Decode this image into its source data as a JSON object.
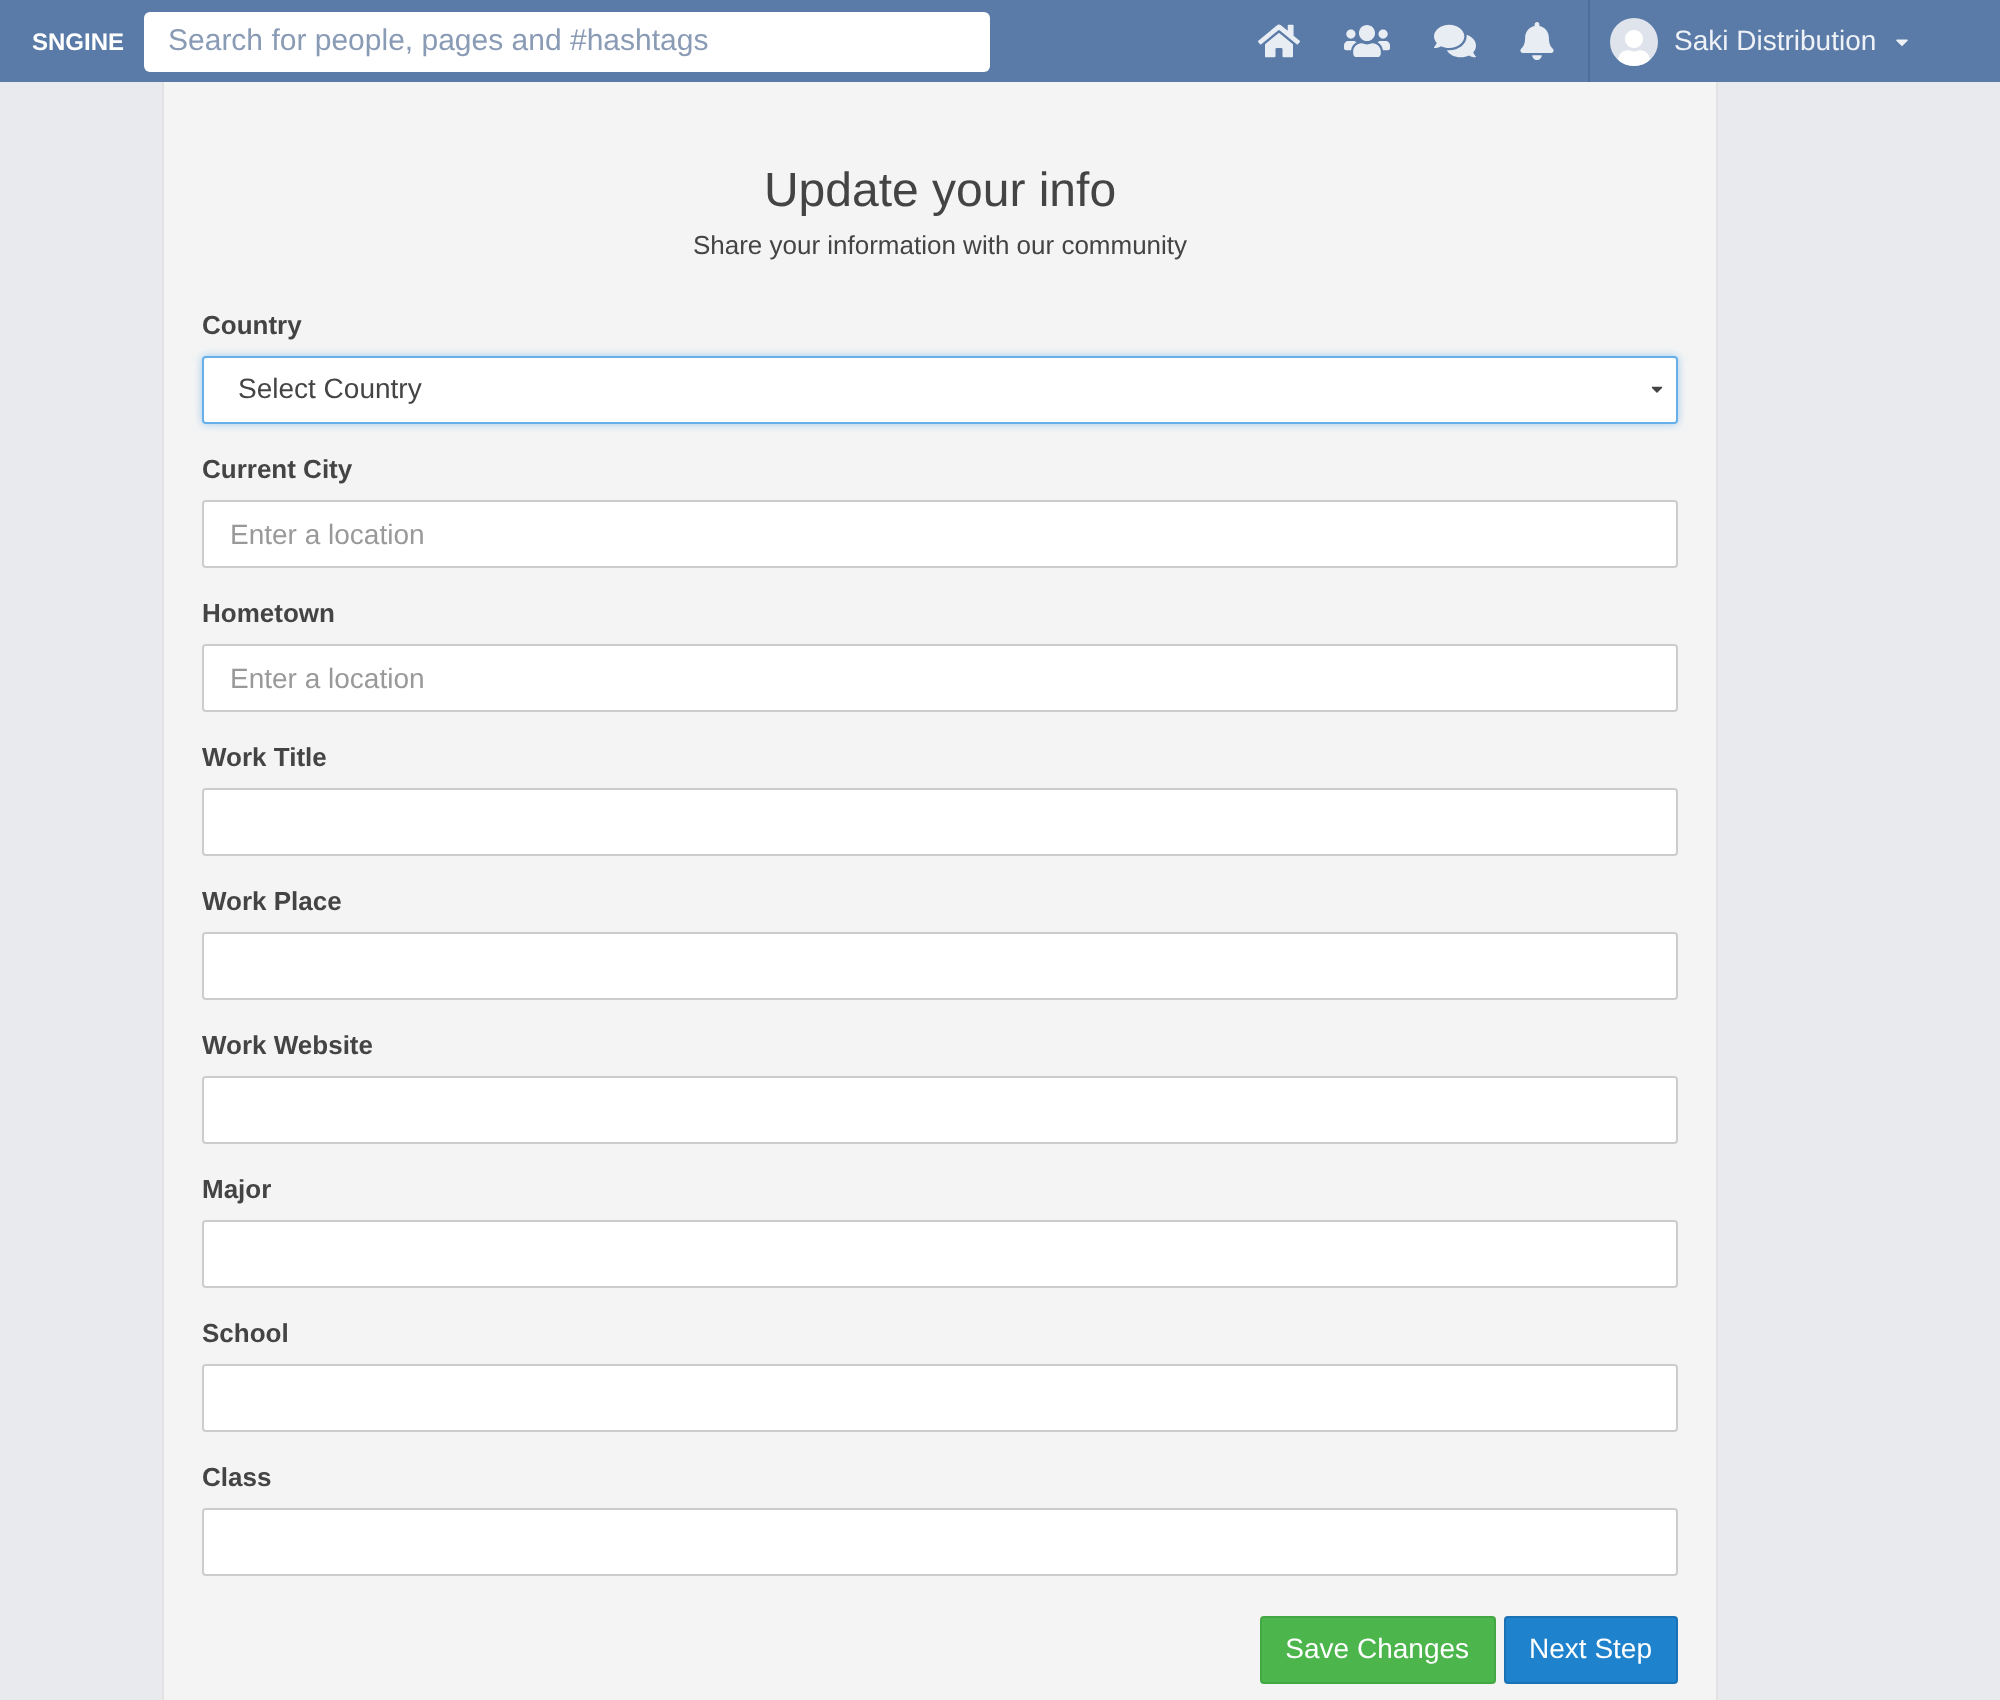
{
  "navbar": {
    "logo": "SNGINE",
    "search": {
      "placeholder": "Search for people, pages and #hashtags"
    },
    "user": {
      "name": "Saki Distribution"
    }
  },
  "form": {
    "title": "Update your info",
    "subtitle": "Share your information with our community",
    "fields": [
      {
        "label": "Country",
        "kind": "select",
        "value": "Select Country",
        "focused": true
      },
      {
        "label": "Current City",
        "kind": "text",
        "placeholder": "Enter a location",
        "focused": false
      },
      {
        "label": "Hometown",
        "kind": "text",
        "placeholder": "Enter a location",
        "focused": false
      },
      {
        "label": "Work Title",
        "kind": "text",
        "focused": false
      },
      {
        "label": "Work Place",
        "kind": "text",
        "focused": false
      },
      {
        "label": "Work Website",
        "kind": "text",
        "focused": false
      },
      {
        "label": "Major",
        "kind": "text",
        "focused": false
      },
      {
        "label": "School",
        "kind": "text",
        "focused": false
      },
      {
        "label": "Class",
        "kind": "text",
        "focused": false
      }
    ],
    "buttons": [
      {
        "label": "Save Changes",
        "kind": "success"
      },
      {
        "label": "Next Step",
        "kind": "primary"
      }
    ]
  }
}
